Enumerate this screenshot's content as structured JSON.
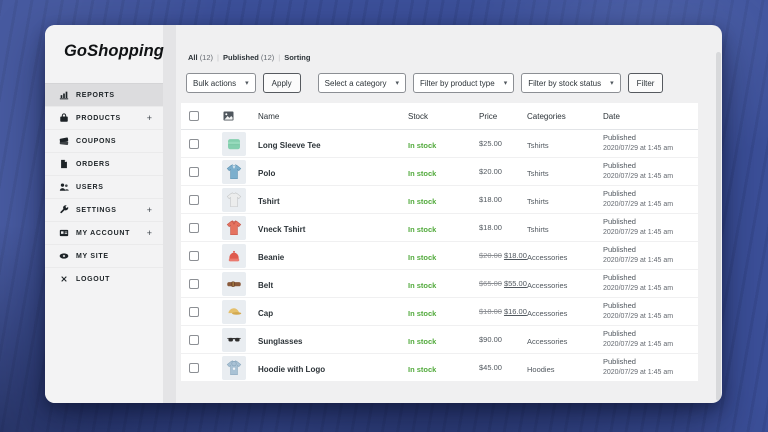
{
  "app": {
    "logo": "GoShopping"
  },
  "sidebar": {
    "items": [
      {
        "label": "REPORTS",
        "icon": "chart-icon",
        "active": true,
        "expandable": false
      },
      {
        "label": "PRODUCTS",
        "icon": "products-bag-icon",
        "active": false,
        "expandable": true
      },
      {
        "label": "COUPONS",
        "icon": "coupons-icon",
        "active": false,
        "expandable": false
      },
      {
        "label": "ORDERS",
        "icon": "orders-icon",
        "active": false,
        "expandable": false
      },
      {
        "label": "USERS",
        "icon": "users-icon",
        "active": false,
        "expandable": false
      },
      {
        "label": "SETTINGS",
        "icon": "wrench-icon",
        "active": false,
        "expandable": true
      },
      {
        "label": "MY ACCOUNT",
        "icon": "id-card-icon",
        "active": false,
        "expandable": true
      },
      {
        "label": "MY SITE",
        "icon": "eye-icon",
        "active": false,
        "expandable": false
      },
      {
        "label": "LOGOUT",
        "icon": "logout-x-icon",
        "active": false,
        "expandable": false
      }
    ]
  },
  "toolbar": {
    "views": [
      {
        "label": "All",
        "count": "(12)"
      },
      {
        "label": "Published",
        "count": "(12)"
      },
      {
        "label": "Sorting",
        "count": ""
      }
    ],
    "separator": "|",
    "bulk_actions": "Bulk actions",
    "apply": "Apply",
    "select_category": "Select a category",
    "filter_product_type": "Filter by product type",
    "filter_stock_status": "Filter by stock status",
    "filter": "Filter"
  },
  "icons": {
    "chevron_down": "▾",
    "plus": "+"
  },
  "table": {
    "columns": {
      "name": "Name",
      "stock": "Stock",
      "price": "Price",
      "categories": "Categories",
      "date": "Date"
    },
    "rows": [
      {
        "name": "Long Sleeve Tee",
        "thumb": "longsleeve",
        "stock": "In stock",
        "price": "$25.00",
        "sale_price": "",
        "categories": "Tshirts",
        "published": "Published",
        "date": "2020/07/29 at 1:45 am"
      },
      {
        "name": "Polo",
        "thumb": "polo",
        "stock": "In stock",
        "price": "$20.00",
        "sale_price": "",
        "categories": "Tshirts",
        "published": "Published",
        "date": "2020/07/29 at 1:45 am"
      },
      {
        "name": "Tshirt",
        "thumb": "tshirt",
        "stock": "In stock",
        "price": "$18.00",
        "sale_price": "",
        "categories": "Tshirts",
        "published": "Published",
        "date": "2020/07/29 at 1:45 am"
      },
      {
        "name": "Vneck Tshirt",
        "thumb": "vneck",
        "stock": "In stock",
        "price": "$18.00",
        "sale_price": "",
        "categories": "Tshirts",
        "published": "Published",
        "date": "2020/07/29 at 1:45 am"
      },
      {
        "name": "Beanie",
        "thumb": "beanie",
        "stock": "In stock",
        "price": "$20.00",
        "sale_price": "$18.00",
        "categories": "Accessories",
        "published": "Published",
        "date": "2020/07/29 at 1:45 am"
      },
      {
        "name": "Belt",
        "thumb": "belt",
        "stock": "In stock",
        "price": "$65.00",
        "sale_price": "$55.00",
        "categories": "Accessories",
        "published": "Published",
        "date": "2020/07/29 at 1:45 am"
      },
      {
        "name": "Cap",
        "thumb": "cap",
        "stock": "In stock",
        "price": "$18.00",
        "sale_price": "$16.00",
        "categories": "Accessories",
        "published": "Published",
        "date": "2020/07/29 at 1:45 am"
      },
      {
        "name": "Sunglasses",
        "thumb": "sunglasses",
        "stock": "In stock",
        "price": "$90.00",
        "sale_price": "",
        "categories": "Accessories",
        "published": "Published",
        "date": "2020/07/29 at 1:45 am"
      },
      {
        "name": "Hoodie with Logo",
        "thumb": "hoodie",
        "stock": "In stock",
        "price": "$45.00",
        "sale_price": "",
        "categories": "Hoodies",
        "published": "Published",
        "date": "2020/07/29 at 1:45 am"
      }
    ]
  },
  "colors": {
    "background_blue": "#3c509a",
    "in_stock_green": "#52aa3c",
    "sidebar_active": "#dcdcde",
    "text_dark": "#2c3338",
    "text_gray": "#646970"
  }
}
